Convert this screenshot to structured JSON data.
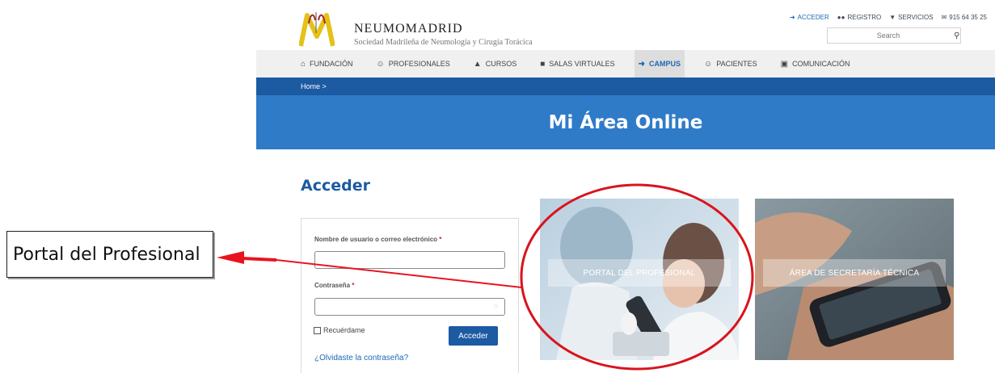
{
  "annotation": {
    "callout_text": "Portal del Profesional",
    "arrow_color": "#e8141d",
    "circle_color": "#d9141d"
  },
  "header": {
    "brand_title": "NEUMOMADRID",
    "brand_subtitle": "Sociedad Madrileña de Neumología y Cirugía Torácica",
    "top_links": [
      {
        "icon": "sign-in-icon",
        "label": "ACCEDER"
      },
      {
        "icon": "users-icon",
        "label": "REGISTRO"
      },
      {
        "icon": "cart-icon",
        "label": "SERVICIOS"
      },
      {
        "icon": "envelope-icon",
        "label": "915 64 35 25"
      }
    ],
    "search_placeholder": "Search"
  },
  "nav": {
    "items": [
      {
        "icon": "home-icon",
        "label": "FUNDACIÓN"
      },
      {
        "icon": "user-icon",
        "label": "PROFESIONALES"
      },
      {
        "icon": "graduation-cap-icon",
        "label": "CURSOS"
      },
      {
        "icon": "video-icon",
        "label": "SALAS VIRTUALES"
      },
      {
        "icon": "sign-in-icon",
        "label": "CAMPUS",
        "active": true
      },
      {
        "icon": "user-icon",
        "label": "PACIENTES"
      },
      {
        "icon": "book-icon",
        "label": "COMUNICACIÓN"
      }
    ]
  },
  "breadcrumb": "Home >",
  "hero_title": "Mi Área Online",
  "login": {
    "heading": "Acceder",
    "username_label": "Nombre de usuario o correo electrónico",
    "password_label": "Contraseña",
    "required_mark": "*",
    "remember_label": "Recuérdame",
    "submit_label": "Acceder",
    "forgot_link": "¿Olvidaste la contraseña?"
  },
  "tiles": [
    {
      "label": "PORTAL DEL PROFESIONAL"
    },
    {
      "label": "ÁREA DE SECRETARÍA TÉCNICA"
    }
  ],
  "colors": {
    "brand_blue": "#1c5aa2",
    "hero_blue": "#2f7bc8",
    "link_blue": "#1c68b6"
  }
}
